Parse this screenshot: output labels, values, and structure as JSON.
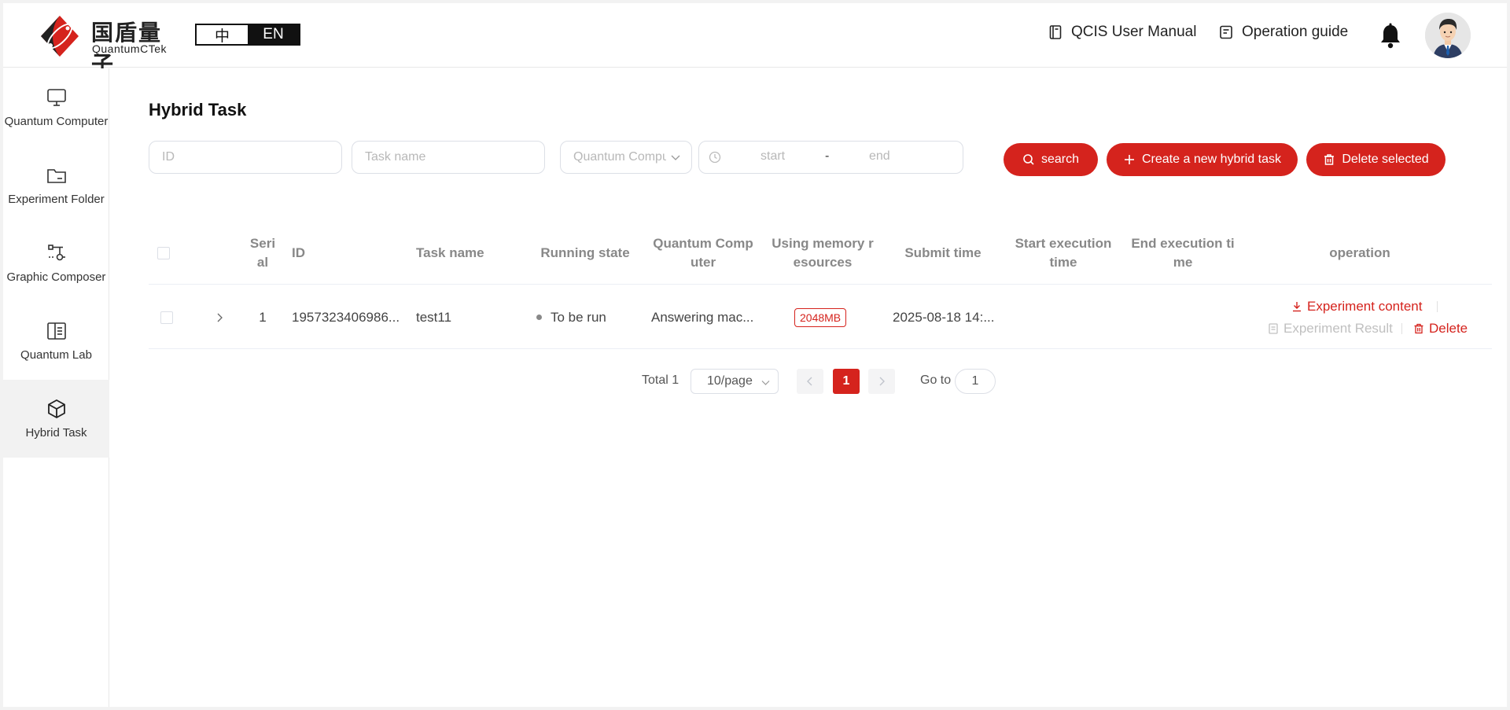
{
  "header": {
    "logo_cn": "国盾量子",
    "logo_en": "QuantumCTek",
    "lang": {
      "zh": "中",
      "en": "EN",
      "active": "EN"
    },
    "manual_label": "QCIS User Manual",
    "guide_label": "Operation guide"
  },
  "sidebar": {
    "items": [
      {
        "label": "Quantum Computer",
        "icon": "monitor-icon"
      },
      {
        "label": "Experiment Folder",
        "icon": "folder-icon"
      },
      {
        "label": "Graphic Composer",
        "icon": "circuit-icon"
      },
      {
        "label": "Quantum Lab",
        "icon": "book-open-icon"
      },
      {
        "label": "Hybrid Task",
        "icon": "cube-icon",
        "active": true
      }
    ]
  },
  "main": {
    "title": "Hybrid Task",
    "filters": {
      "id_placeholder": "ID",
      "task_name_placeholder": "Task name",
      "computer_placeholder": "Quantum Compu",
      "start_placeholder": "start",
      "end_placeholder": "end",
      "range_separator": "-"
    },
    "buttons": {
      "search": "search",
      "create": "Create a new hybrid task",
      "delete_selected": "Delete selected"
    },
    "table": {
      "headers": {
        "serial": "Seri\nal",
        "id": "ID",
        "task_name": "Task name",
        "running_state": "Running state",
        "quantum_computer": "Quantum Comp\nuter",
        "memory": "Using memory r\nesources",
        "submit_time": "Submit time",
        "start_time": "Start execution\ntime",
        "end_time": "End execution ti\nme",
        "operation": "operation"
      },
      "rows": [
        {
          "serial": "1",
          "id": "1957323406986...",
          "task_name": "test11",
          "running_state": "To be run",
          "quantum_computer": "Answering mac...",
          "memory": "2048MB",
          "submit_time": "2025-08-18 14:...",
          "start_time": "",
          "end_time": "",
          "ops": {
            "experiment_content": "Experiment content",
            "experiment_result": "Experiment Result",
            "delete": "Delete"
          }
        }
      ]
    },
    "pagination": {
      "total": "Total 1",
      "page_size": "10/page",
      "current_page": "1",
      "goto_label": "Go to",
      "goto_value": "1"
    }
  },
  "colors": {
    "accent": "#d5231d",
    "active_bg": "#f2f2f2"
  }
}
